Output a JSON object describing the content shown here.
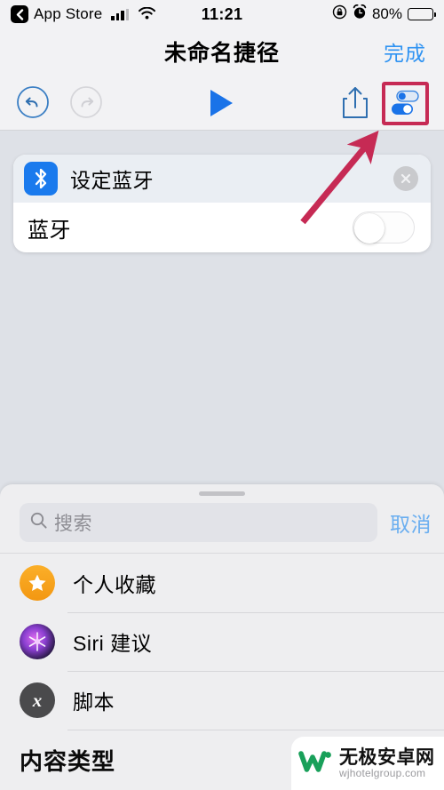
{
  "status_bar": {
    "back_label": "App Store",
    "back_icon": "chevron-left-icon",
    "signal_icon": "cellular-signal-icon",
    "wifi_icon": "wifi-icon",
    "time": "11:21",
    "rotation_lock_icon": "rotation-lock-icon",
    "alarm_icon": "alarm-clock-icon",
    "battery_percent": "80%",
    "battery_icon": "battery-icon"
  },
  "nav_bar": {
    "title": "未命名捷径",
    "done_label": "完成"
  },
  "toolbar": {
    "undo_icon": "undo-icon",
    "redo_icon": "redo-icon",
    "play_icon": "play-icon",
    "share_icon": "share-icon",
    "settings_icon": "toggles-settings-icon",
    "highlight_color": "#c62a54"
  },
  "action_card": {
    "app_icon": "bluetooth-icon",
    "app_icon_color": "#1a7aed",
    "title": "设定蓝牙",
    "close_icon": "close-circle-icon",
    "row_label": "蓝牙",
    "toggle_state": "off",
    "toggle_icon": "switch-toggle-off-icon"
  },
  "annotation": {
    "arrow_icon": "pointer-arrow-icon",
    "arrow_color": "#c62a54"
  },
  "sheet": {
    "grabber_icon": "drag-handle-icon",
    "search": {
      "icon": "search-icon",
      "placeholder": "搜索",
      "value": ""
    },
    "cancel_label": "取消",
    "items": [
      {
        "label": "个人收藏",
        "icon": "star-icon"
      },
      {
        "label": "Siri 建议",
        "icon": "siri-orb-icon"
      },
      {
        "label": "脚本",
        "icon": "script-x-icon"
      }
    ],
    "section_header": "内容类型"
  },
  "watermark": {
    "logo_icon": "w-logo-icon",
    "name": "无极安卓网",
    "url": "wjhotelgroup.com",
    "logo_color": "#19a05a"
  }
}
